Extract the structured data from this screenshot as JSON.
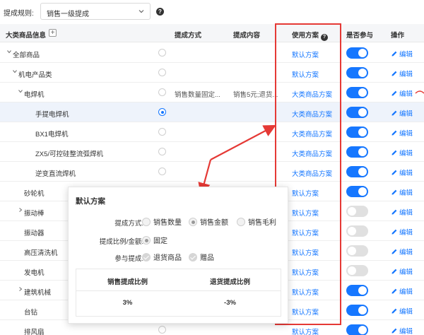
{
  "toolbar": {
    "rule_label": "提成规则:",
    "rule_value": "销售一级提成"
  },
  "columns": {
    "category": "大类商品信息",
    "method": "提成方式",
    "content": "提成内容",
    "plan": "使用方案",
    "participate": "是否参与",
    "action": "操作"
  },
  "edit_label": "编辑",
  "rows": [
    {
      "name": "全部商品",
      "indent": 1,
      "caret": "down",
      "selected": false,
      "method": "",
      "content": "",
      "plan": "默认方案",
      "enabled": true
    },
    {
      "name": "机电产品类",
      "indent": 2,
      "caret": "down",
      "selected": false,
      "method": "",
      "content": "",
      "plan": "默认方案",
      "enabled": true
    },
    {
      "name": "电焊机",
      "indent": 3,
      "caret": "down",
      "selected": false,
      "method": "销售数量固定...",
      "content": "销售5元;退货...",
      "plan": "大类商品方案",
      "enabled": true
    },
    {
      "name": "手提电焊机",
      "indent": 4,
      "caret": "",
      "selected": true,
      "method": "",
      "content": "",
      "plan": "大类商品方案",
      "enabled": true
    },
    {
      "name": "BX1电焊机",
      "indent": 4,
      "caret": "",
      "selected": false,
      "method": "",
      "content": "",
      "plan": "大类商品方案",
      "enabled": true
    },
    {
      "name": "ZX5/可控硅整流弧焊机",
      "indent": 4,
      "caret": "",
      "selected": false,
      "method": "",
      "content": "",
      "plan": "大类商品方案",
      "enabled": true
    },
    {
      "name": "逆变直流焊机",
      "indent": 4,
      "caret": "",
      "selected": false,
      "method": "",
      "content": "",
      "plan": "大类商品方案",
      "enabled": true
    },
    {
      "name": "砂轮机",
      "indent": 3,
      "caret": "",
      "selected": false,
      "method": "",
      "content": "",
      "plan": "默认方案",
      "enabled": true
    },
    {
      "name": "振动棒",
      "indent": 3,
      "caret": "right",
      "selected": false,
      "method": "",
      "content": "",
      "plan": "默认方案",
      "enabled": false
    },
    {
      "name": "振动器",
      "indent": 3,
      "caret": "",
      "selected": false,
      "method": "",
      "content": "",
      "plan": "默认方案",
      "enabled": false
    },
    {
      "name": "高压清洗机",
      "indent": 3,
      "caret": "",
      "selected": false,
      "method": "",
      "content": "",
      "plan": "默认方案",
      "enabled": false
    },
    {
      "name": "发电机",
      "indent": 3,
      "caret": "",
      "selected": false,
      "method": "",
      "content": "",
      "plan": "默认方案",
      "enabled": false
    },
    {
      "name": "建筑机械",
      "indent": 3,
      "caret": "right",
      "selected": false,
      "method": "",
      "content": "",
      "plan": "默认方案",
      "enabled": true
    },
    {
      "name": "台钻",
      "indent": 3,
      "caret": "",
      "selected": false,
      "method": "",
      "content": "",
      "plan": "默认方案",
      "enabled": true
    },
    {
      "name": "排风扇",
      "indent": 3,
      "caret": "",
      "selected": false,
      "method": "",
      "content": "",
      "plan": "默认方案",
      "enabled": true
    }
  ],
  "popup": {
    "title": "默认方案",
    "method_label": "提成方式:",
    "method_options": [
      "销售数量",
      "销售金额",
      "销售毛利"
    ],
    "method_selected": "销售金额",
    "ratio_label": "提成比例/金额:",
    "ratio_option": "固定",
    "participate_label": "参与提成:",
    "participate_options": [
      "退货商品",
      "赠品"
    ],
    "table_headers": [
      "销售提成比例",
      "退货提成比例"
    ],
    "table_values": [
      "3%",
      "-3%"
    ]
  },
  "colors": {
    "accent": "#1677ff",
    "annotation": "#e53935"
  }
}
